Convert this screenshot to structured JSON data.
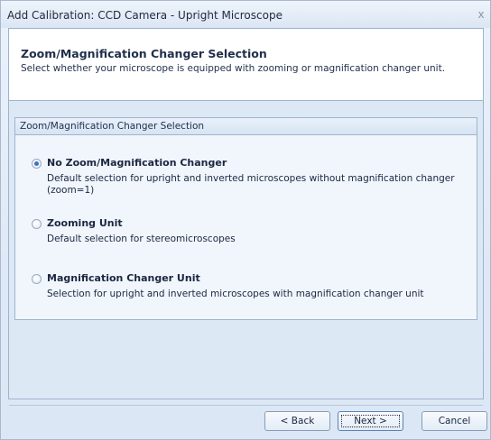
{
  "window": {
    "title": "Add Calibration: CCD Camera - Upright Microscope",
    "close_glyph": "x"
  },
  "header": {
    "title": "Zoom/Magnification Changer Selection",
    "subtitle": "Select whether your microscope is equipped with zooming or magnification changer unit."
  },
  "group": {
    "title": "Zoom/Magnification Changer Selection",
    "options": [
      {
        "label": "No Zoom/Magnification Changer",
        "description": "Default selection for upright and inverted microscopes without magnification changer (zoom=1)",
        "checked": true
      },
      {
        "label": "Zooming Unit",
        "description": "Default selection for stereomicroscopes",
        "checked": false
      },
      {
        "label": "Magnification Changer Unit",
        "description": "Selection for upright and inverted microscopes with magnification changer unit",
        "checked": false
      }
    ]
  },
  "buttons": {
    "back": "< Back",
    "next": "Next >",
    "cancel": "Cancel"
  },
  "colors": {
    "accent": "#3a6fc4",
    "border": "#9fb3cf",
    "panel": "#dde8f5"
  }
}
